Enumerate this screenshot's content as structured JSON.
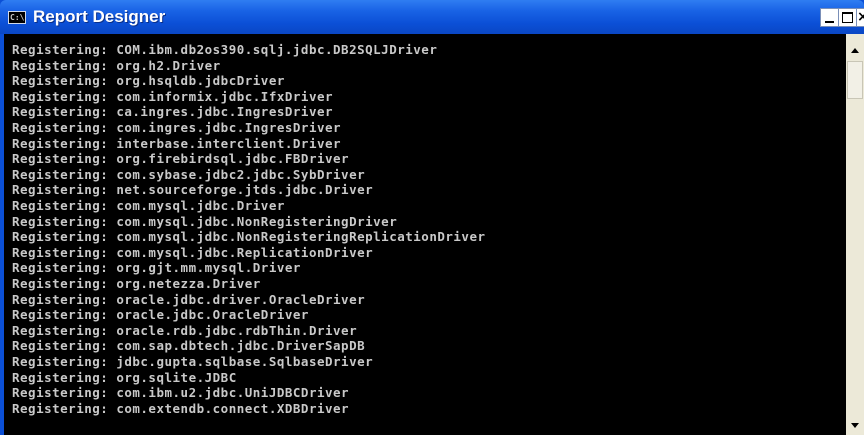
{
  "window": {
    "title": "Report Designer",
    "app_icon_text": "C:\\",
    "close_glyph": "×"
  },
  "console": {
    "lines": [
      "Registering: COM.ibm.db2os390.sqlj.jdbc.DB2SQLJDriver",
      "Registering: org.h2.Driver",
      "Registering: org.hsqldb.jdbcDriver",
      "Registering: com.informix.jdbc.IfxDriver",
      "Registering: ca.ingres.jdbc.IngresDriver",
      "Registering: com.ingres.jdbc.IngresDriver",
      "Registering: interbase.interclient.Driver",
      "Registering: org.firebirdsql.jdbc.FBDriver",
      "Registering: com.sybase.jdbc2.jdbc.SybDriver",
      "Registering: net.sourceforge.jtds.jdbc.Driver",
      "Registering: com.mysql.jdbc.Driver",
      "Registering: com.mysql.jdbc.NonRegisteringDriver",
      "Registering: com.mysql.jdbc.NonRegisteringReplicationDriver",
      "Registering: com.mysql.jdbc.ReplicationDriver",
      "Registering: org.gjt.mm.mysql.Driver",
      "Registering: org.netezza.Driver",
      "Registering: oracle.jdbc.driver.OracleDriver",
      "Registering: oracle.jdbc.OracleDriver",
      "Registering: oracle.rdb.jdbc.rdbThin.Driver",
      "Registering: com.sap.dbtech.jdbc.DriverSapDB",
      "Registering: jdbc.gupta.sqlbase.SqlbaseDriver",
      "Registering: org.sqlite.JDBC",
      "Registering: com.ibm.u2.jdbc.UniJDBCDriver",
      "Registering: com.extendb.connect.XDBDriver"
    ]
  },
  "colors": {
    "titlebar": "#0b4fd6",
    "console_bg": "#000000",
    "console_text": "#c9c9c9"
  }
}
